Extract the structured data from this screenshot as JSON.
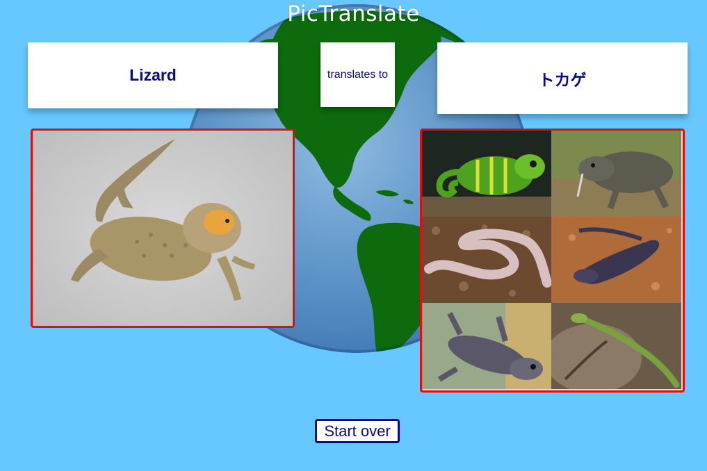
{
  "header": {
    "title": "PicTranslate"
  },
  "translation": {
    "source_word": "Lizard",
    "connector": "translates to",
    "target_word": "トカゲ"
  },
  "source_image": {
    "icon": "bearded-dragon-photo"
  },
  "target_images": [
    {
      "icon": "chameleon-photo"
    },
    {
      "icon": "monitor-lizard-photo"
    },
    {
      "icon": "legless-lizard-photo"
    },
    {
      "icon": "blue-tongued-skink-photo"
    },
    {
      "icon": "gecko-photo"
    },
    {
      "icon": "green-lizard-photo"
    }
  ],
  "footer": {
    "start_over_label": "Start over"
  },
  "colors": {
    "background": "#66c8ff",
    "frame_border": "#e50c0c",
    "text_navy": "#0a0a8a",
    "globe_land": "#0d6b0d"
  }
}
